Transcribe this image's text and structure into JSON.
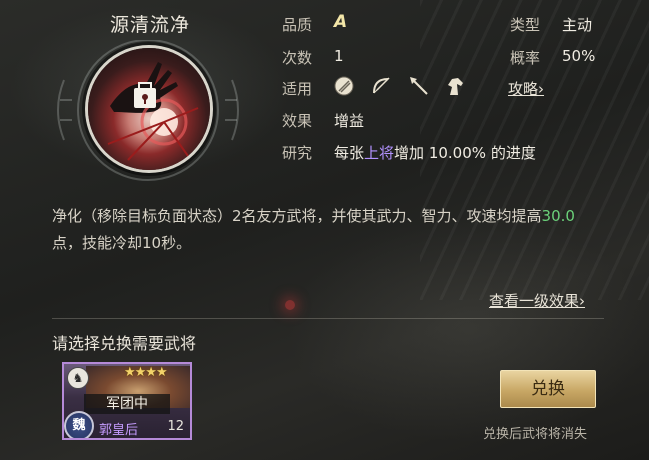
{
  "skill": {
    "name": "源清流净",
    "icon": "purify-buff-skill-art"
  },
  "info": {
    "quality_label": "品质",
    "quality_value": "A",
    "type_label": "类型",
    "type_value": "主动",
    "count_label": "次数",
    "count_value": "1",
    "rate_label": "概率",
    "rate_value": "50%",
    "applicable_label": "适用",
    "troop_icons": [
      "shield-icon",
      "bow-icon",
      "spear-icon",
      "horse-icon"
    ],
    "guide_link": "攻略",
    "effect_label": "效果",
    "effect_value": "增益",
    "research_label": "研究",
    "research_prefix": "每张",
    "research_highlight": "上将",
    "research_middle": "增加",
    "research_percent": "10.00%",
    "research_suffix": "的进度"
  },
  "description": {
    "part1": "净化（移除目标负面状态）2名友方武将，并使其武力、智力、攻速均提高",
    "value": "30.0",
    "part2": "点，技能冷却10秒。"
  },
  "level_one_link": "查看一级效果",
  "select_title": "请选择兑换需要武将",
  "general_card": {
    "unit_icon": "horse-icon",
    "stars": "★★★★",
    "tag": "军团中",
    "faction": "魏",
    "name": "郭皇后",
    "level": "12"
  },
  "exchange_button": "兑换",
  "exchange_note": "兑换后武将将消失",
  "colors": {
    "accent_gold": "#c8a765",
    "highlight_purple": "#b292ff",
    "highlight_green": "#6bd17a"
  }
}
